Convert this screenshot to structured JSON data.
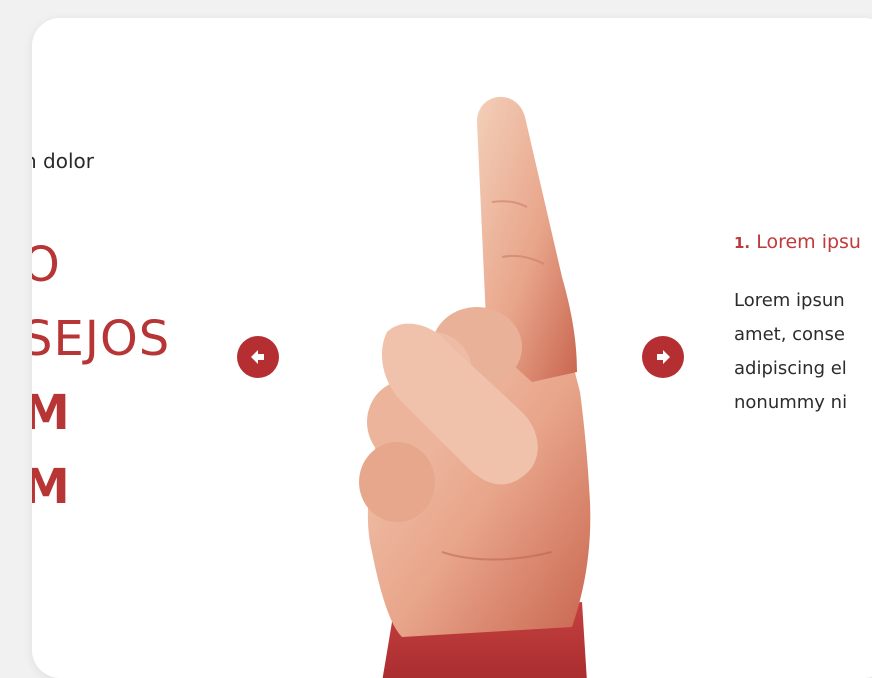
{
  "intro_text": "n dolor",
  "headline": {
    "line1": "O",
    "line2": "SEJOS",
    "line3": "M",
    "line4": "M"
  },
  "navigation": {
    "prev_icon": "arrow-left-icon",
    "next_icon": "arrow-right-icon"
  },
  "step": {
    "number": "1.",
    "title": "Lorem ipsu",
    "body_lines": [
      "Lorem ipsun",
      "amet, conse",
      "adipiscing el",
      "nonummy ni"
    ]
  },
  "colors": {
    "accent": "#b52f32",
    "headline": "#b73535",
    "background": "#f1f1f1",
    "card": "#ffffff"
  }
}
